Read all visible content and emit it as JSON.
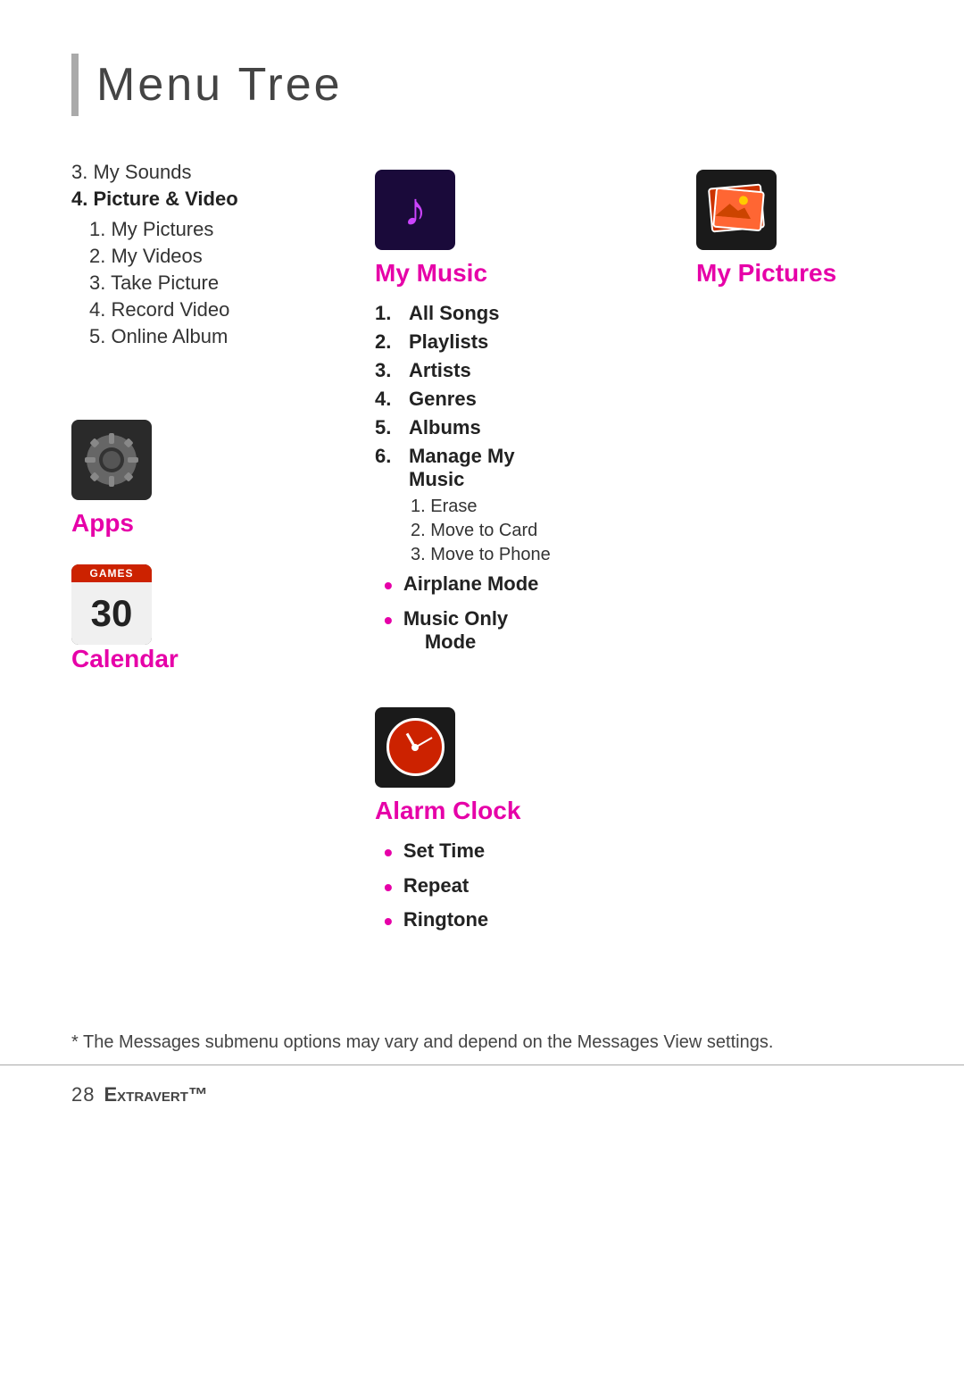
{
  "page": {
    "title": "Menu Tree",
    "footer_note": "* The Messages submenu options may vary and depend on the Messages View settings.",
    "footer_page": "28",
    "footer_brand": "Extravert™"
  },
  "left_column": {
    "pv_section": {
      "item3_label": "3.  My Sounds",
      "item4_label": "4. Picture & Video",
      "sub_items": [
        "1.  My Pictures",
        "2.  My Videos",
        "3.  Take Picture",
        "4.  Record Video",
        "5.  Online Album"
      ]
    },
    "apps_label": "Apps",
    "calendar_header": "GAMES",
    "calendar_number": "30",
    "calendar_label": "Calendar"
  },
  "mid_column": {
    "music_title": "My Music",
    "music_items": [
      {
        "num": "1.",
        "label": "All Songs",
        "bold": true
      },
      {
        "num": "2.",
        "label": "Playlists",
        "bold": true
      },
      {
        "num": "3.",
        "label": "Artists",
        "bold": true
      },
      {
        "num": "4.",
        "label": "Genres",
        "bold": true
      },
      {
        "num": "5.",
        "label": "Albums",
        "bold": true
      },
      {
        "num": "6.",
        "label": "Manage My Music",
        "bold": true
      }
    ],
    "manage_sub_items": [
      "1.  Erase",
      "2.  Move to Card",
      "3.  Move to Phone"
    ],
    "bullet_items": [
      {
        "label": "Airplane Mode"
      },
      {
        "label": "Music Only Mode"
      }
    ],
    "alarm_title": "Alarm Clock",
    "alarm_items": [
      {
        "label": "Set Time"
      },
      {
        "label": "Repeat"
      },
      {
        "label": "Ringtone"
      }
    ]
  },
  "right_column": {
    "pictures_title": "My Pictures"
  }
}
